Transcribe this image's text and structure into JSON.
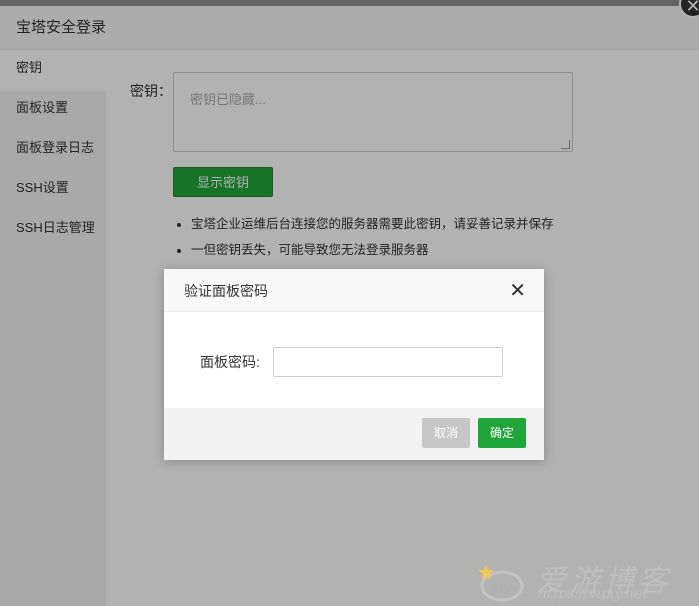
{
  "panel": {
    "title": "宝塔安全登录",
    "close_glyph": "✕",
    "sidebar": {
      "items": [
        {
          "label": "密钥"
        },
        {
          "label": "面板设置"
        },
        {
          "label": "面板登录日志"
        },
        {
          "label": "SSH设置"
        },
        {
          "label": "SSH日志管理"
        }
      ]
    },
    "key_field": {
      "label": "密钥：",
      "placeholder": "密钥已隐藏..."
    },
    "show_key_button": "显示密钥",
    "notes": [
      "宝塔企业运维后台连接您的服务器需要此密钥，请妥善记录并保存",
      "一但密钥丢失，可能导致您无法登录服务器"
    ]
  },
  "dialog": {
    "title": "验证面板密码",
    "close_glyph": "✕",
    "password_label": "面板密码:",
    "password_value": "",
    "cancel_label": "取消",
    "confirm_label": "确定"
  },
  "watermark": {
    "title": "爱游博客",
    "url": "https://vipiy.net"
  },
  "colors": {
    "accent_green": "#20a53a",
    "overlay": "rgba(0,0,0,0.3)",
    "cancel_gray": "#c7c7c7"
  }
}
